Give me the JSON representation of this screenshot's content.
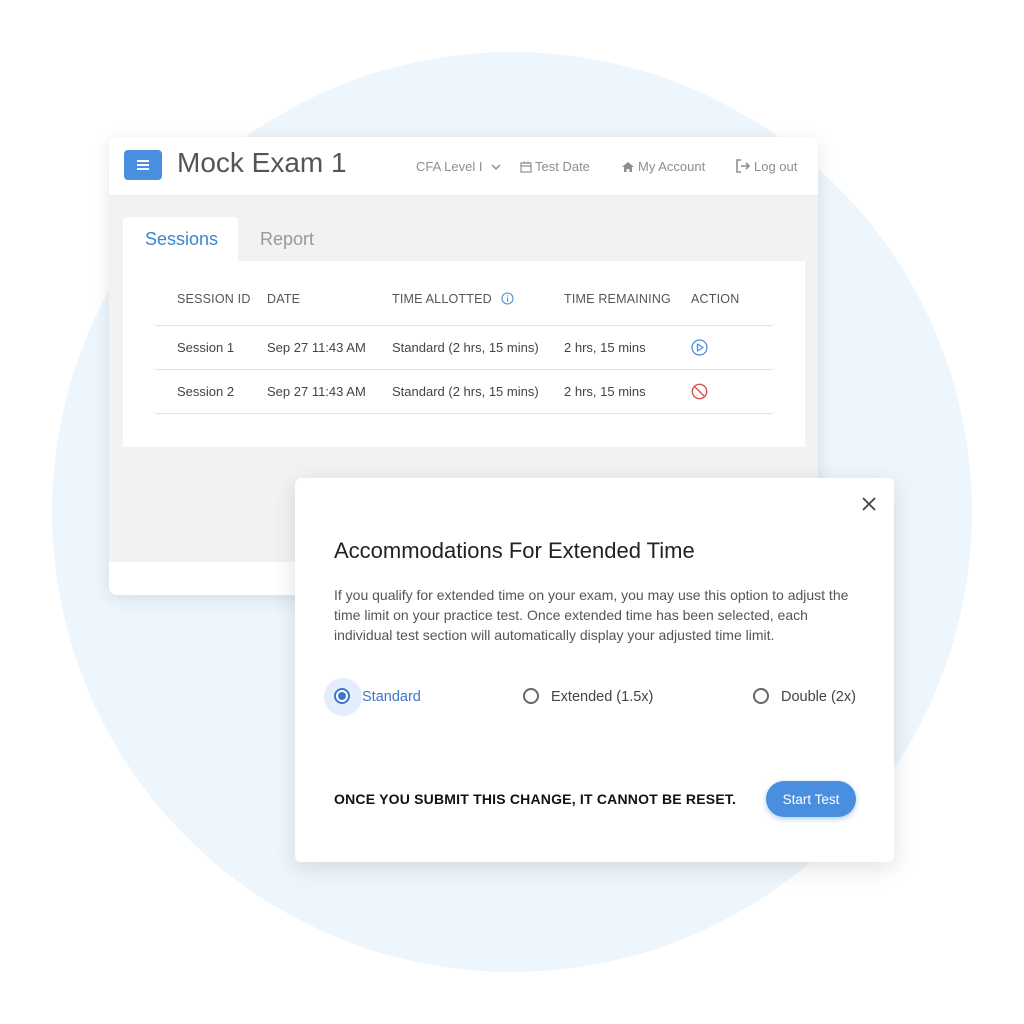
{
  "header": {
    "title": "Mock Exam 1",
    "nav": {
      "level": "CFA Level I",
      "test_date": "Test Date",
      "account": "My Account",
      "logout": "Log out"
    }
  },
  "tabs": {
    "sessions": "Sessions",
    "report": "Report",
    "active": "Sessions"
  },
  "table": {
    "headers": [
      "SESSION ID",
      "DATE",
      "TIME ALLOTTED",
      "TIME REMAINING",
      "ACTION"
    ],
    "rows": [
      {
        "session": "Session 1",
        "date": "Sep 27  11:43 AM",
        "allotted": "Standard (2 hrs, 15 mins)",
        "remaining": "2 hrs, 15 mins",
        "action_icon": "play-circle-icon"
      },
      {
        "session": "Session 2",
        "date": "Sep 27  11:43 AM",
        "allotted": "Standard (2 hrs, 15 mins)",
        "remaining": "2 hrs, 15 mins",
        "action_icon": "no-entry-icon"
      }
    ]
  },
  "modal": {
    "title": "Accommodations For Extended Time",
    "description": "If you qualify for extended time on your exam, you may use this option to adjust the time limit on your practice test. Once extended time has been selected, each individual test section will automatically display your adjusted time limit.",
    "options": [
      {
        "label": "Standard",
        "selected": true
      },
      {
        "label": "Extended (1.5x)",
        "selected": false
      },
      {
        "label": "Double (2x)",
        "selected": false
      }
    ],
    "warning": "ONCE YOU SUBMIT THIS CHANGE, IT CANNOT BE RESET.",
    "button": "Start Test"
  },
  "colors": {
    "accent": "#4a8ee0",
    "selected_radio": "#3b77c9",
    "background_circle": "#eef6fd",
    "disabled_action": "#d9534f"
  }
}
